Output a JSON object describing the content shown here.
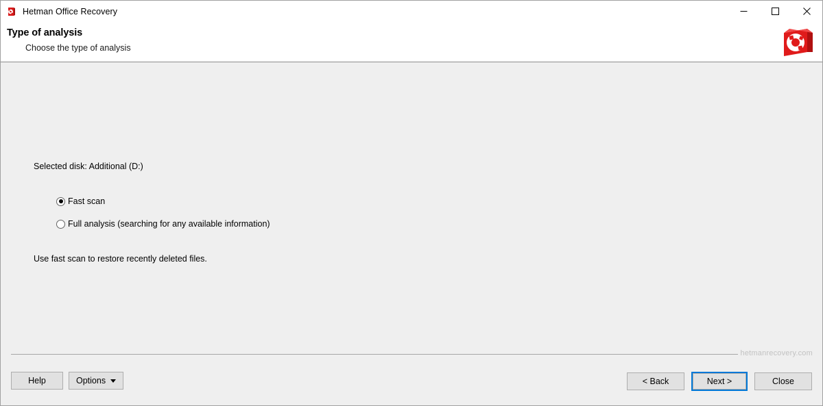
{
  "window": {
    "title": "Hetman Office Recovery",
    "app_icon": "hetman-app-icon",
    "controls": {
      "minimize": "minimize-icon",
      "maximize": "maximize-icon",
      "close": "close-icon"
    }
  },
  "header": {
    "title": "Type of analysis",
    "subtitle": "Choose the type of analysis",
    "logo": "hetman-logo",
    "brand_color": "#d91a1a"
  },
  "main": {
    "selected_disk": "Selected disk: Additional (D:)",
    "options": [
      {
        "label": "Fast scan",
        "checked": true
      },
      {
        "label": "Full analysis (searching for any available information)",
        "checked": false
      }
    ],
    "hint": "Use fast scan to restore recently deleted files."
  },
  "footer": {
    "watermark": "hetmanrecovery.com",
    "help_label": "Help",
    "options_label": "Options",
    "options_caret": "chevron-down-icon",
    "back_label": "< Back",
    "next_label": "Next >",
    "close_label": "Close",
    "focus_color": "#0078d7"
  }
}
